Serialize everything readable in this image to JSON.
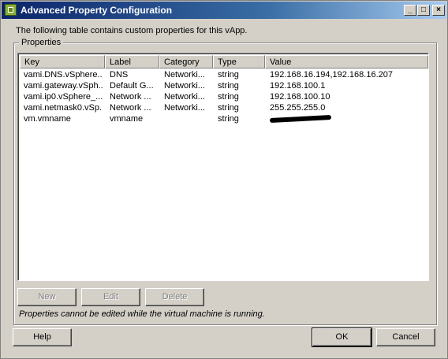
{
  "window": {
    "title": "Advanced Property Configuration",
    "controls": {
      "minimize": "_",
      "maximize": "□",
      "close": "×"
    }
  },
  "intro_text": "The following table contains custom properties for this vApp.",
  "properties_group": {
    "label": "Properties",
    "columns": [
      "Key",
      "Label",
      "Category",
      "Type",
      "Value"
    ],
    "rows": [
      {
        "key": "vami.DNS.vSphere...",
        "label": "DNS",
        "category": "Networki...",
        "type": "string",
        "value": "192.168.16.194,192.168.16.207"
      },
      {
        "key": "vami.gateway.vSph...",
        "label": "Default G...",
        "category": "Networki...",
        "type": "string",
        "value": "192.168.100.1"
      },
      {
        "key": "vami.ip0.vSphere_...",
        "label": "Network ...",
        "category": "Networki...",
        "type": "string",
        "value": "192.168.100.10"
      },
      {
        "key": "vami.netmask0.vSp...",
        "label": "Network ...",
        "category": "Networki...",
        "type": "string",
        "value": "255.255.255.0"
      },
      {
        "key": "vm.vmname",
        "label": "vmname",
        "category": "",
        "type": "string",
        "value": ""
      }
    ],
    "buttons": {
      "new": "New",
      "edit": "Edit",
      "delete": "Delete"
    },
    "note": "Properties cannot be edited while the virtual machine is running."
  },
  "footer": {
    "help": "Help",
    "ok": "OK",
    "cancel": "Cancel"
  },
  "icons": {
    "app": "vapp-icon",
    "redaction": "redaction-mark"
  }
}
